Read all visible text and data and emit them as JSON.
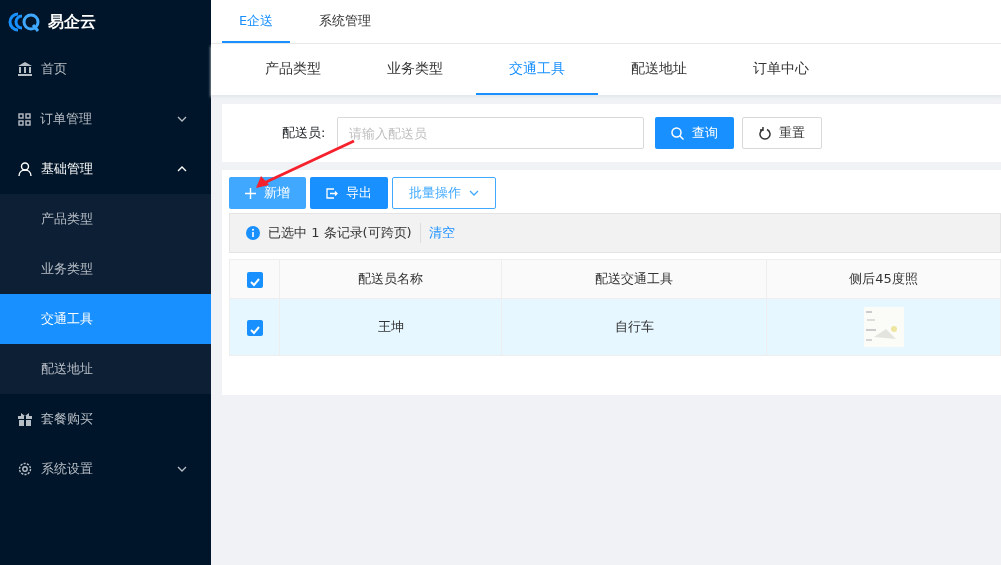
{
  "logo": {
    "title": "易企云"
  },
  "sidebar": {
    "items": [
      {
        "label": "首页",
        "selected": false
      },
      {
        "label": "订单管理",
        "selected": false,
        "expanded": false
      },
      {
        "label": "基础管理",
        "selected": false,
        "expanded": true,
        "children": [
          {
            "label": "产品类型",
            "selected": false
          },
          {
            "label": "业务类型",
            "selected": false
          },
          {
            "label": "交通工具",
            "selected": true
          },
          {
            "label": "配送地址",
            "selected": false
          }
        ]
      },
      {
        "label": "套餐购买",
        "selected": false
      },
      {
        "label": "系统设置",
        "selected": false,
        "expanded": false
      }
    ]
  },
  "top_tabs": [
    {
      "label": "E企送",
      "selected": true
    },
    {
      "label": "系统管理",
      "selected": false
    }
  ],
  "sub_tabs": [
    {
      "label": "产品类型",
      "selected": false
    },
    {
      "label": "业务类型",
      "selected": false
    },
    {
      "label": "交通工具",
      "selected": true
    },
    {
      "label": "配送地址",
      "selected": false
    },
    {
      "label": "订单中心",
      "selected": false
    }
  ],
  "search": {
    "label": "配送员:",
    "placeholder": "请输入配送员",
    "query_button": "查询",
    "reset_button": "重置"
  },
  "toolbar": {
    "add_button": "新增",
    "export_button": "导出",
    "batch_button": "批量操作"
  },
  "selection_alert": {
    "text": "已选中 1 条记录(可跨页)",
    "clear_link": "清空"
  },
  "table": {
    "all_checked": true,
    "columns": [
      "配送员名称",
      "配送交通工具",
      "侧后45度照"
    ],
    "rows": [
      {
        "checked": true,
        "selected": true,
        "cells": [
          "王坤",
          "自行车"
        ],
        "photo": {
          "kind": "picture"
        }
      }
    ]
  }
}
